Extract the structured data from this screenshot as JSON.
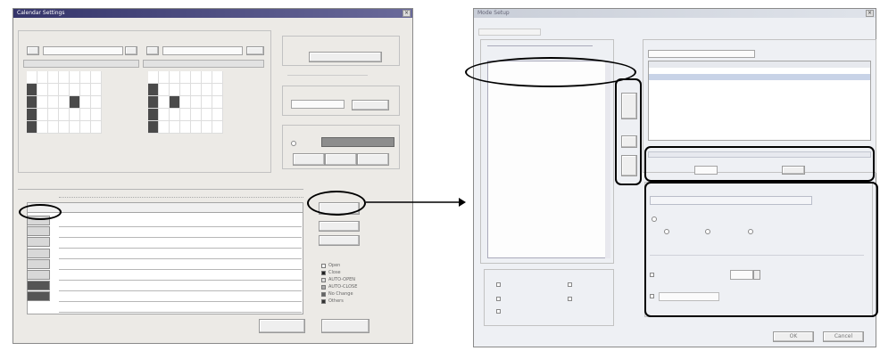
{
  "window1": {
    "title": "Calendar Settings",
    "legend": [
      "Open",
      "Close",
      "AUTO-OPEN",
      "AUTO-CLOSE",
      "No Change",
      "Others"
    ]
  },
  "window2": {
    "title": "Mode Setup",
    "ok_label": "OK",
    "cancel_label": "Cancel"
  },
  "colors": {
    "annotation": "#000000",
    "title_dark": "#34346a",
    "dark_cell": "#4a4a4a",
    "holiday_cell": "#8f8f8f"
  }
}
